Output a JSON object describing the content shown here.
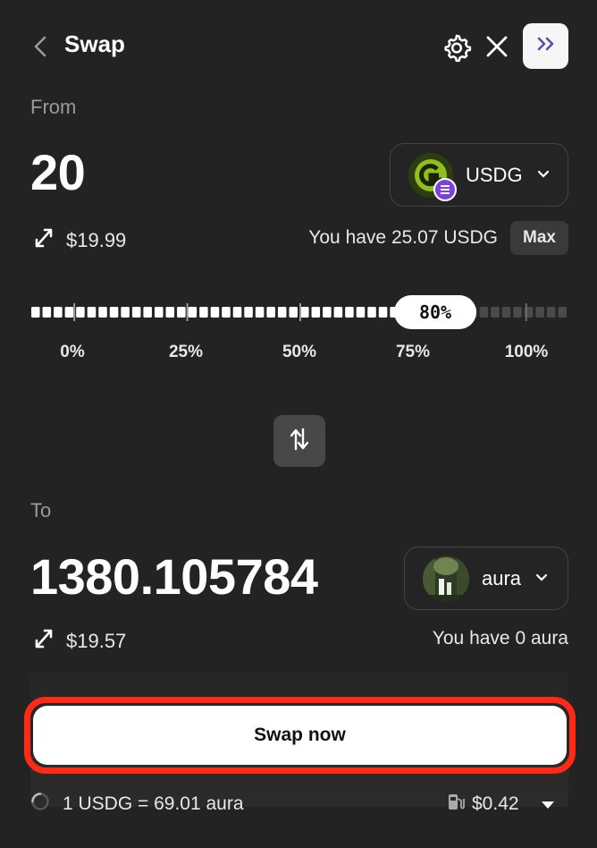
{
  "header": {
    "title": "Swap"
  },
  "from": {
    "label": "From",
    "amount": "20",
    "token_symbol": "USDG",
    "usd_value": "$19.99",
    "balance_text": "You have 25.07 USDG",
    "max_label": "Max"
  },
  "slider": {
    "value_label": "80%",
    "value_fraction": 0.8,
    "ticks": [
      "0%",
      "25%",
      "50%",
      "75%",
      "100%"
    ]
  },
  "to": {
    "label": "To",
    "amount": "1380.105784",
    "token_symbol": "aura",
    "usd_value": "$19.57",
    "balance_text": "You have 0 aura"
  },
  "cta": {
    "label": "Swap now"
  },
  "footer": {
    "rate_text": "1 USDG = 69.01 aura",
    "gas_fee": "$0.42"
  },
  "colors": {
    "background": "#232323",
    "highlight": "#ff2a16",
    "usdg_green": "#8fbe1e",
    "badge_purple": "#7b3fe4"
  },
  "icons": {
    "back": "chevron-left-icon",
    "settings": "gear-icon",
    "close": "close-icon",
    "expand": "double-chevron-right-icon",
    "usd_toggle": "diagonal-arrows-icon",
    "swap_direction": "up-down-arrows-icon",
    "gas": "fuel-pump-icon"
  }
}
